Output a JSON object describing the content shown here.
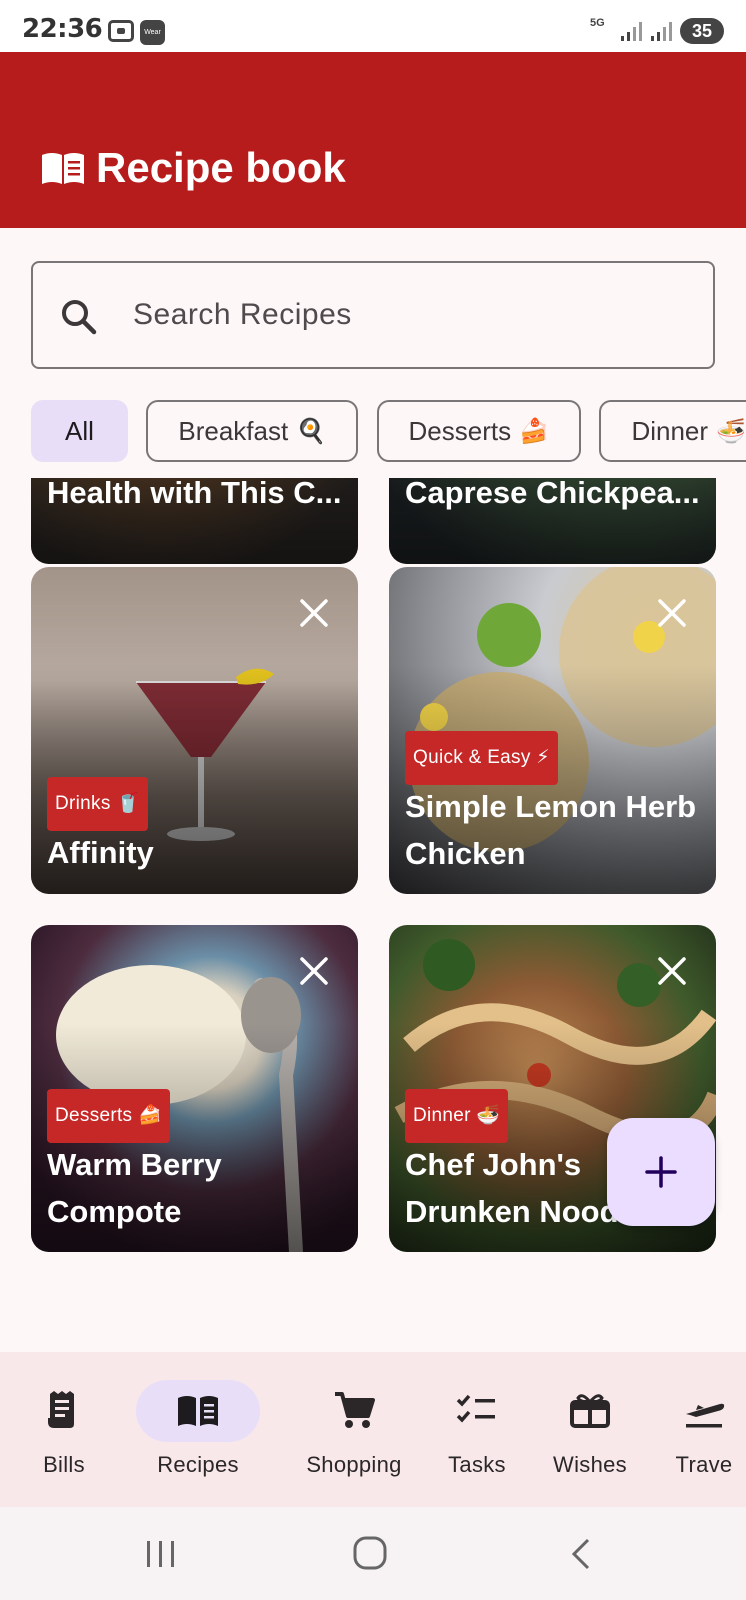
{
  "status_bar": {
    "time": "22:36",
    "wear_label": "Wear",
    "network": "5G",
    "battery": "35"
  },
  "app_bar": {
    "title": "Recipe book",
    "icon": "open-book-icon"
  },
  "search": {
    "placeholder": "Search Recipes",
    "value": ""
  },
  "filters": [
    {
      "label": "All",
      "emoji": "",
      "selected": true
    },
    {
      "label": "Breakfast",
      "emoji": "🍳",
      "selected": false
    },
    {
      "label": "Desserts",
      "emoji": "🍰",
      "selected": false
    },
    {
      "label": "Dinner",
      "emoji": "🍜",
      "selected": false
    }
  ],
  "recipes": [
    {
      "title": "Health with This C...",
      "tag": "",
      "tag_emoji": ""
    },
    {
      "title": "Caprese Chickpea...",
      "tag": "",
      "tag_emoji": ""
    },
    {
      "title": "Affinity",
      "tag": "Drinks",
      "tag_emoji": "🥤"
    },
    {
      "title": "Simple Lemon Herb Chicken",
      "tag": "Quick & Easy",
      "tag_emoji": "⚡"
    },
    {
      "title": "Warm Berry Compote",
      "tag": "Desserts",
      "tag_emoji": "🍰"
    },
    {
      "title": "Chef John's Drunken Noodles",
      "tag": "Dinner",
      "tag_emoji": "🍜"
    }
  ],
  "fab": {
    "icon": "plus-icon"
  },
  "bottom_nav": [
    {
      "label": "Bills",
      "icon": "receipt-icon",
      "active": false
    },
    {
      "label": "Recipes",
      "icon": "open-book-icon",
      "active": true
    },
    {
      "label": "Shopping",
      "icon": "cart-icon",
      "active": false
    },
    {
      "label": "Tasks",
      "icon": "checklist-icon",
      "active": false
    },
    {
      "label": "Wishes",
      "icon": "gift-icon",
      "active": false
    },
    {
      "label": "Trave",
      "icon": "plane-icon",
      "active": false
    }
  ],
  "colors": {
    "app_bar": "#b71c1c",
    "tag": "#c62828",
    "selected_chip": "#e8def8",
    "fab": "#eaddff",
    "nav_bg": "#f8e8ea"
  }
}
